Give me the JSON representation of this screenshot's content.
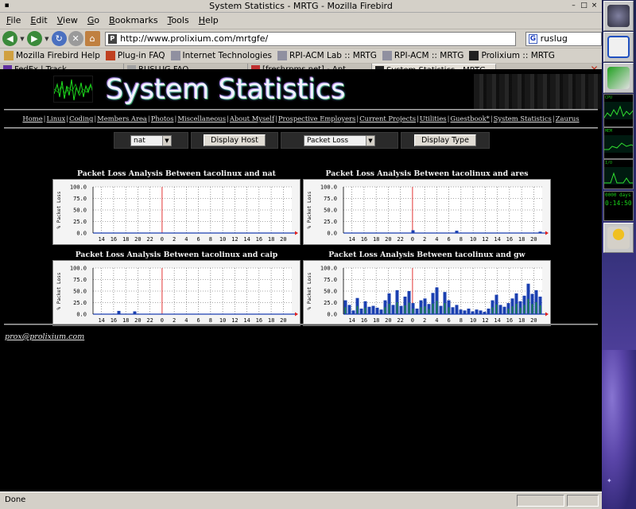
{
  "window": {
    "title": "System Statistics - MRTG - Mozilla Firebird"
  },
  "menu": [
    {
      "label": "File",
      "u": "F",
      "rest": "ile"
    },
    {
      "label": "Edit",
      "u": "E",
      "rest": "dit"
    },
    {
      "label": "View",
      "u": "V",
      "rest": "iew"
    },
    {
      "label": "Go",
      "u": "G",
      "rest": "o"
    },
    {
      "label": "Bookmarks",
      "u": "B",
      "rest": "ookmarks"
    },
    {
      "label": "Tools",
      "u": "T",
      "rest": "ools"
    },
    {
      "label": "Help",
      "u": "H",
      "rest": "elp"
    }
  ],
  "navbar": {
    "url": "http://www.prolixium.com/mrtgfe/",
    "search_value": "ruslug"
  },
  "bookmarks": [
    {
      "label": "Mozilla Firebird Help",
      "icon": "document-icon",
      "color": "#d0a040"
    },
    {
      "label": "Plug-in FAQ",
      "icon": "plugin-icon",
      "color": "#c04020"
    },
    {
      "label": "Internet Technologies",
      "icon": "document-icon",
      "color": "#9090a0"
    },
    {
      "label": "RPI-ACM Lab :: MRTG",
      "icon": "document-icon",
      "color": "#9090a0"
    },
    {
      "label": "RPI-ACM :: MRTG",
      "icon": "document-icon",
      "color": "#9090a0"
    },
    {
      "label": "Prolixium :: MRTG",
      "icon": "prolixium-icon",
      "color": "#202020"
    }
  ],
  "tabs": [
    {
      "label": "FedEx | Track",
      "icon": "fedex-icon",
      "color": "#6030a0",
      "active": false
    },
    {
      "label": "RUSLUG FAQ",
      "icon": "document-icon",
      "color": "#a0a0a0",
      "active": false
    },
    {
      "label": "[freshrpms.net] - Apt",
      "icon": "freshrpms-icon",
      "color": "#c03030",
      "active": false
    },
    {
      "label": "System Statistics - MRTG",
      "icon": "prolixium-icon",
      "color": "#202020",
      "active": true
    }
  ],
  "page": {
    "title": "System Statistics",
    "nav_links": [
      "Home",
      "Linux",
      "Coding",
      "Members Area",
      "Photos",
      "Miscellaneous",
      "About Myself",
      "Prospective Employers",
      "Current Projects",
      "Utilities",
      "Guestbook*",
      "System Statistics",
      "Zaurus"
    ],
    "host_select": "nat",
    "host_button": "Display Host",
    "type_select": "Packet Loss",
    "type_button": "Display Type",
    "footer_email": "prox@prolixium.com"
  },
  "status": {
    "text": "Done"
  },
  "desktop": {
    "cpu_label": "CPU",
    "mem_label": "MEM",
    "io_label": "I/O",
    "uptime": "0000 days",
    "clock": "0:14:50"
  },
  "chart_data": [
    {
      "type": "bar",
      "title": "Packet Loss Analysis Between tacolinux and nat",
      "ylabel": "% Packet Loss",
      "ylim": [
        0,
        100
      ],
      "yticks": [
        "100.0",
        "75.0",
        "50.0",
        "25.0",
        "0.0"
      ],
      "xticks": [
        "14",
        "16",
        "18",
        "20",
        "22",
        "0",
        "2",
        "4",
        "6",
        "8",
        "10",
        "12",
        "14",
        "16",
        "18",
        "20"
      ],
      "series": [
        {
          "values": [
            0,
            0,
            0,
            0,
            0,
            0,
            0,
            0,
            0,
            0,
            0,
            0,
            0,
            0,
            0,
            0,
            0,
            0,
            0,
            0,
            0,
            0,
            0,
            0,
            0,
            0,
            0,
            0,
            0,
            0,
            0,
            0,
            0,
            0,
            0,
            0,
            0,
            0,
            0,
            0,
            0,
            0,
            0,
            0,
            0,
            0,
            0,
            0,
            0,
            0
          ]
        }
      ]
    },
    {
      "type": "bar",
      "title": "Packet Loss Analysis Between tacolinux and ares",
      "ylabel": "% Packet Loss",
      "ylim": [
        0,
        100
      ],
      "yticks": [
        "100.0",
        "75.0",
        "50.0",
        "25.0",
        "0.0"
      ],
      "xticks": [
        "14",
        "16",
        "18",
        "20",
        "22",
        "0",
        "2",
        "4",
        "6",
        "8",
        "10",
        "12",
        "14",
        "16",
        "18",
        "20"
      ],
      "series": [
        {
          "values": [
            0,
            0,
            0,
            0,
            0,
            0,
            0,
            0,
            0,
            0,
            0,
            0,
            0,
            0,
            0,
            0,
            0,
            6,
            0,
            0,
            0,
            0,
            0,
            0,
            0,
            0,
            0,
            0,
            5,
            0,
            0,
            0,
            0,
            0,
            0,
            0,
            0,
            0,
            0,
            0,
            0,
            0,
            0,
            0,
            0,
            0,
            0,
            0,
            0,
            3
          ]
        }
      ]
    },
    {
      "type": "bar",
      "title": "Packet Loss Analysis Between tacolinux and caip",
      "ylabel": "% Packet Loss",
      "ylim": [
        0,
        100
      ],
      "yticks": [
        "100.0",
        "75.0",
        "50.0",
        "25.0",
        "0.0"
      ],
      "xticks": [
        "14",
        "16",
        "18",
        "20",
        "22",
        "0",
        "2",
        "4",
        "6",
        "8",
        "10",
        "12",
        "14",
        "16",
        "18",
        "20"
      ],
      "series": [
        {
          "values": [
            0,
            0,
            0,
            0,
            0,
            0,
            7,
            0,
            0,
            0,
            6,
            0,
            0,
            0,
            0,
            0,
            0,
            0,
            0,
            0,
            0,
            0,
            0,
            0,
            0,
            0,
            0,
            0,
            0,
            0,
            0,
            0,
            0,
            0,
            0,
            0,
            0,
            0,
            0,
            0,
            0,
            0,
            0,
            0,
            0,
            0,
            0,
            0,
            0,
            0
          ]
        }
      ]
    },
    {
      "type": "bar",
      "title": "Packet Loss Analysis Between tacolinux and gw",
      "ylabel": "% Packet Loss",
      "ylim": [
        0,
        100
      ],
      "yticks": [
        "100.0",
        "75.0",
        "50.0",
        "25.0",
        "0.0"
      ],
      "xticks": [
        "14",
        "16",
        "18",
        "20",
        "22",
        "0",
        "2",
        "4",
        "6",
        "8",
        "10",
        "12",
        "14",
        "16",
        "18",
        "20"
      ],
      "series": [
        {
          "values": [
            30,
            20,
            8,
            35,
            12,
            28,
            16,
            18,
            14,
            10,
            30,
            45,
            20,
            52,
            18,
            38,
            50,
            24,
            12,
            30,
            34,
            22,
            46,
            58,
            18,
            48,
            30,
            15,
            20,
            10,
            8,
            12,
            6,
            10,
            8,
            5,
            12,
            30,
            42,
            20,
            16,
            24,
            34,
            45,
            28,
            40,
            66,
            44,
            52,
            38
          ]
        }
      ]
    }
  ]
}
